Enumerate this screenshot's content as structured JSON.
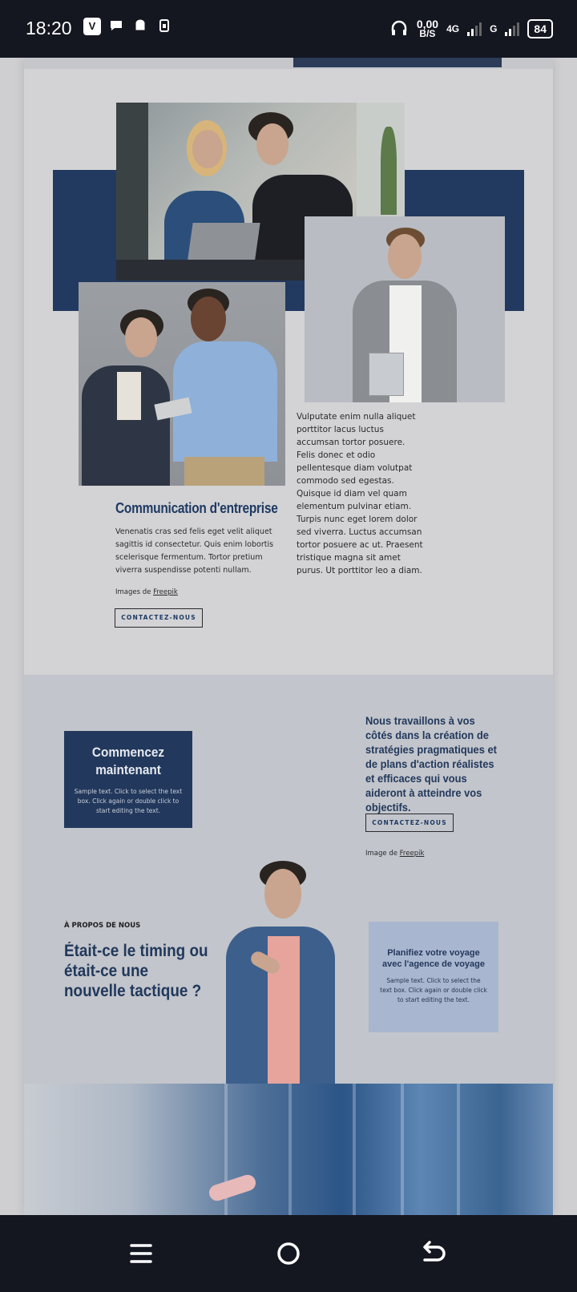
{
  "status_bar": {
    "time": "18:20",
    "net_speed_value": "0,00",
    "net_speed_unit": "B/S",
    "network_4g": "4G",
    "network_g": "G",
    "battery": "84"
  },
  "section1": {
    "right_paragraph": "Vulputate enim nulla aliquet porttitor lacus luctus accumsan tortor posuere. Felis donec et odio pellentesque diam volutpat commodo sed egestas. Quisque id diam vel quam elementum pulvinar etiam. Turpis nunc eget lorem dolor sed viverra. Luctus accumsan tortor posuere ac ut. Praesent tristique magna sit amet purus. Ut porttitor leo a diam.",
    "heading": "Communication d'entreprise",
    "paragraph": "Venenatis cras sed felis eget velit aliquet sagittis id consectetur. Quis enim lobortis scelerisque fermentum. Tortor pretium viverra suspendisse potenti nullam.",
    "credit_prefix": "Images de",
    "credit_link": "Freepik",
    "button": "CONTACTEZ-NOUS"
  },
  "section2": {
    "card_dark_title": "Commencez maintenant",
    "card_dark_text": "Sample text. Click to select the text box. Click again or double click to start editing the text.",
    "work_text": "Nous travaillons à vos côtés dans la création de stratégies pragmatiques et de plans d'action réalistes et efficaces qui vous aideront à atteindre vos objectifs.",
    "button": "CONTACTEZ-NOUS",
    "credit_prefix": "Image de",
    "credit_link": "Freepik",
    "about_label": "À PROPOS DE NOUS",
    "about_heading": "Était-ce le timing ou était-ce une nouvelle tactique ?",
    "card_light_title": "Planifiez votre voyage avec l'agence de voyage",
    "card_light_text": "Sample text. Click to select the text box. Click again or double click to start editing the text."
  },
  "colors": {
    "brand_dark_blue": "#22385c",
    "light_blue_card": "#a9b6cf",
    "status_bar": "#141620"
  }
}
